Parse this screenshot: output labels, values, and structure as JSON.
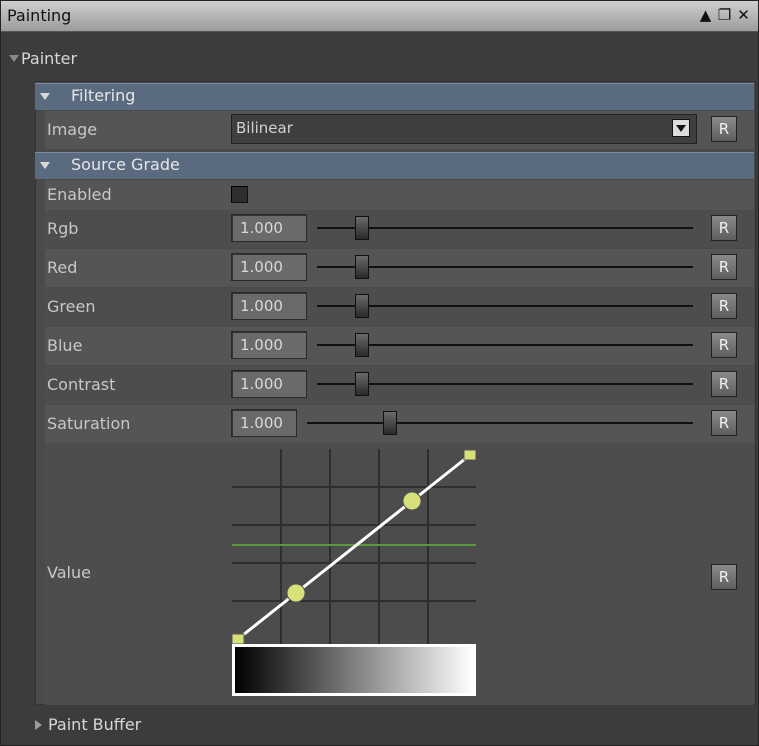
{
  "window": {
    "title": "Painting",
    "icons": [
      "move-up-icon",
      "restore-window-icon",
      "close-icon"
    ]
  },
  "painter": {
    "label": "Painter",
    "filtering": {
      "label": "Filtering",
      "image": {
        "label": "Image",
        "value": "Bilinear",
        "reset_label": "R"
      }
    },
    "source_grade": {
      "label": "Source Grade",
      "enabled": {
        "label": "Enabled",
        "checked": false
      },
      "params": [
        {
          "label": "Rgb",
          "value": "1.000",
          "reset_label": "R"
        },
        {
          "label": "Red",
          "value": "1.000",
          "reset_label": "R"
        },
        {
          "label": "Green",
          "value": "1.000",
          "reset_label": "R"
        },
        {
          "label": "Blue",
          "value": "1.000",
          "reset_label": "R"
        },
        {
          "label": "Contrast",
          "value": "1.000",
          "reset_label": "R"
        },
        {
          "label": "Saturation",
          "value": "1.000",
          "reset_label": "R"
        }
      ],
      "value_curve": {
        "label": "Value",
        "reset_label": "R",
        "points": [
          [
            0,
            0
          ],
          [
            0.25,
            0.25
          ],
          [
            0.75,
            0.75
          ],
          [
            1,
            1
          ]
        ]
      }
    },
    "paint_buffer": {
      "label": "Paint Buffer"
    }
  },
  "colors": {
    "section_header": "#5a6b80",
    "curve_line": "#ffffff",
    "curve_point": "#d8e07a",
    "midline": "#5a9a3a"
  }
}
